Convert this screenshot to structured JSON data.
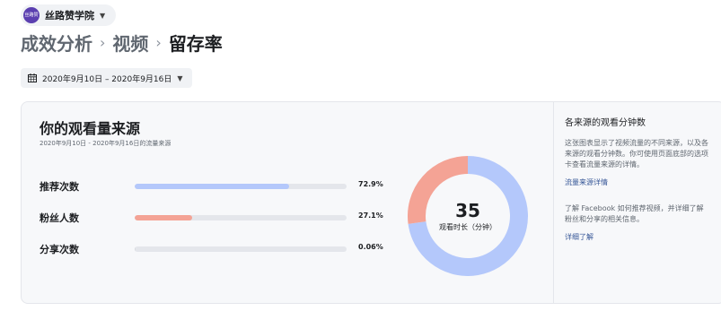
{
  "page_selector": {
    "avatar_text": "丝路赞学院",
    "name": "丝路赞学院"
  },
  "breadcrumb": {
    "items": [
      "成效分析",
      "视频",
      "留存率"
    ]
  },
  "date_range": {
    "label": "2020年9月10日 – 2020年9月16日"
  },
  "card": {
    "title": "你的观看量来源",
    "subtitle": "2020年9月10日 - 2020年9月16日的流量来源",
    "metrics": [
      {
        "label": "推荐次数",
        "value_text": "72.9%",
        "value": 72.9,
        "color": "#b4c8fb"
      },
      {
        "label": "粉丝人数",
        "value_text": "27.1%",
        "value": 27.1,
        "color": "#f4a395"
      },
      {
        "label": "分享次数",
        "value_text": "0.06%",
        "value": 0.06,
        "color": "#d8dadf"
      }
    ],
    "donut": {
      "number": "35",
      "caption": "观看时长（分钟）",
      "slices": [
        {
          "value": 72.9,
          "color": "#b4c8fb"
        },
        {
          "value": 27.1,
          "color": "#f4a395"
        }
      ]
    }
  },
  "sidebar": {
    "title": "各来源的观看分钟数",
    "description": "这张图表显示了视频流量的不同来源，以及各来源的观看分钟数。你可使用页面底部的选项卡查看流量来源的详情。",
    "link1": "流量来源详情",
    "description2": "了解 Facebook 如何推荐视频，并详细了解粉丝和分享的相关信息。",
    "link2": "详细了解"
  }
}
